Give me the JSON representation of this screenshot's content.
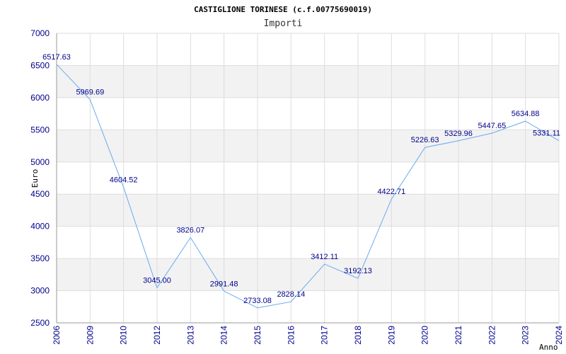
{
  "chart_data": {
    "type": "line",
    "title": "CASTIGLIONE TORINESE (c.f.00775690019)",
    "subtitle": "Importi",
    "xlabel": "Anno",
    "ylabel": "Euro",
    "ylim": [
      2500,
      7000
    ],
    "yticks": [
      2500,
      3000,
      3500,
      4000,
      4500,
      5000,
      5500,
      6000,
      6500,
      7000
    ],
    "grid": true,
    "categories": [
      "2006",
      "2009",
      "2010",
      "2012",
      "2013",
      "2014",
      "2015",
      "2016",
      "2017",
      "2018",
      "2019",
      "2020",
      "2021",
      "2022",
      "2023",
      "2024"
    ],
    "values": [
      6517.63,
      5969.69,
      4604.52,
      3045.0,
      3826.07,
      2991.48,
      2733.08,
      2828.14,
      3412.11,
      3192.13,
      4422.71,
      5226.63,
      5329.96,
      5447.65,
      5634.88,
      5331.11
    ],
    "labels": [
      "6517.63",
      "5969.69",
      "4604.52",
      "3045.00",
      "3826.07",
      "2991.48",
      "2733.08",
      "2828.14",
      "3412.11",
      "3192.13",
      "4422.71",
      "5226.63",
      "5329.96",
      "5447.65",
      "5634.88",
      "5331.11"
    ],
    "line_color": "#6aaaf0",
    "band_color": "#f2f2f2"
  }
}
